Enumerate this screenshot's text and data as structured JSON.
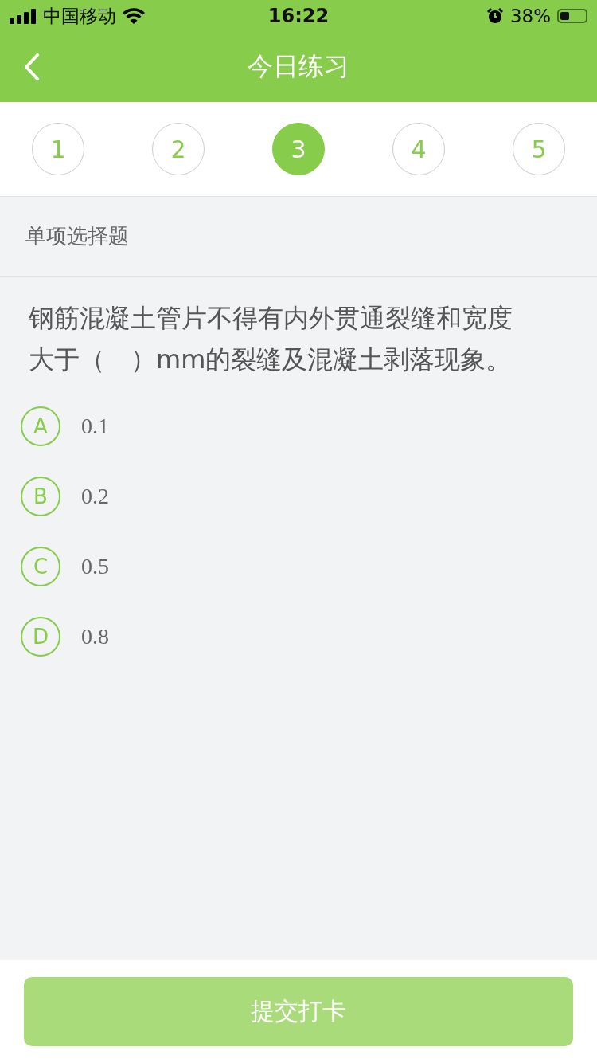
{
  "status_bar": {
    "carrier": "中国移动",
    "time": "16:22",
    "battery": "38%"
  },
  "nav": {
    "title": "今日练习"
  },
  "steps": [
    {
      "label": "1",
      "selected": false
    },
    {
      "label": "2",
      "selected": false
    },
    {
      "label": "3",
      "selected": true
    },
    {
      "label": "4",
      "selected": false
    },
    {
      "label": "5",
      "selected": false
    }
  ],
  "question_type": "单项选择题",
  "question": "钢筋混凝土管片不得有内外贯通裂缝和宽度大于（　）mm的裂缝及混凝土剥落现象。",
  "options": [
    {
      "letter": "A",
      "text": "0.1"
    },
    {
      "letter": "B",
      "text": "0.2"
    },
    {
      "letter": "C",
      "text": "0.5"
    },
    {
      "letter": "D",
      "text": "0.8"
    }
  ],
  "submit": {
    "label": "提交打卡",
    "disabled": true
  }
}
